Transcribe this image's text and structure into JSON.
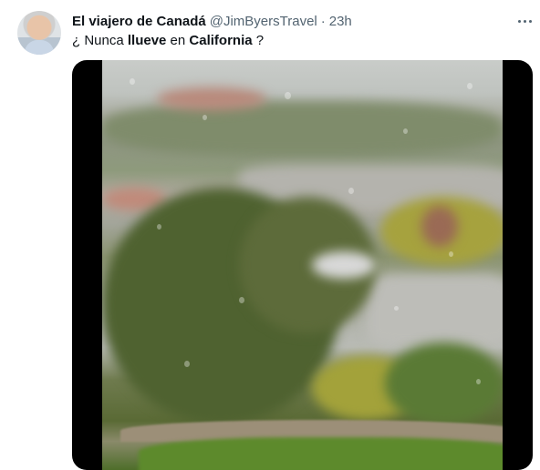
{
  "tweet": {
    "display_name": "El viajero de Canadá",
    "handle": "@JimByersTravel",
    "separator": "·",
    "timestamp": "23h",
    "more_icon": "more-horizontal-icon",
    "text_parts": {
      "p1": "¿ Nunca ",
      "p2": "llueve",
      "p3": " en ",
      "p4": "California",
      "p5": " ?"
    }
  },
  "media": {
    "type": "video",
    "scene": "rainy-window-landscape"
  }
}
